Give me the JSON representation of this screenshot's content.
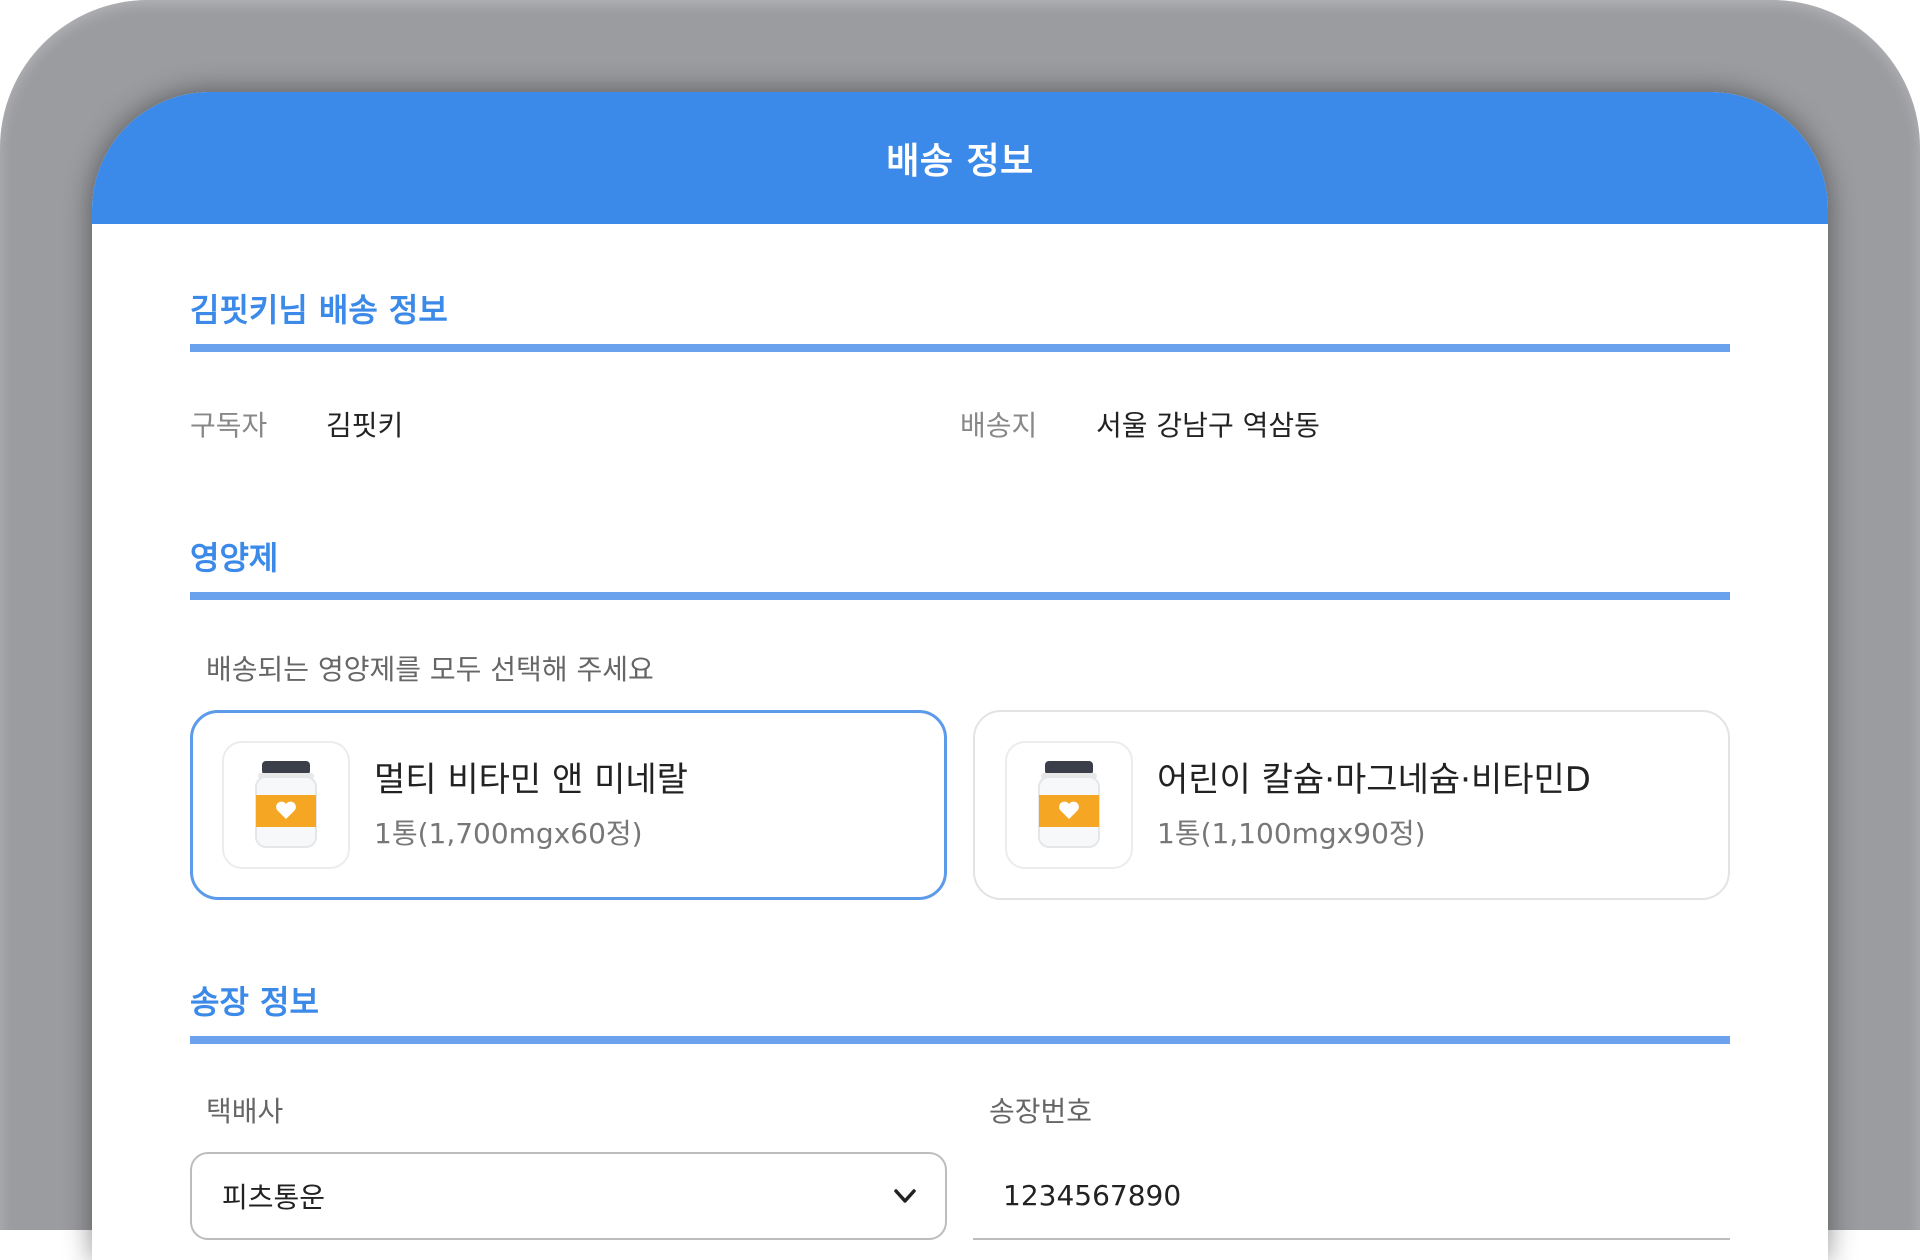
{
  "header": {
    "title": "배송 정보"
  },
  "delivery_info": {
    "title": "김핏키님 배송 정보",
    "subscriber_label": "구독자",
    "subscriber_value": "김핏키",
    "address_label": "배송지",
    "address_value": "서울 강남구 역삼동"
  },
  "supplements": {
    "title": "영양제",
    "hint": "배송되는 영양제를 모두 선택해 주세요",
    "items": [
      {
        "name": "멀티 비타민 앤 미네랄",
        "detail": "1통(1,700mgx60정)",
        "selected": true,
        "icon": "supplement-bottle-icon"
      },
      {
        "name": "어린이 칼슘·마그네슘·비타민D",
        "detail": "1통(1,100mgx90정)",
        "selected": false,
        "icon": "supplement-bottle-icon"
      }
    ]
  },
  "invoice": {
    "title": "송장 정보",
    "courier_label": "택배사",
    "courier_value": "피츠통운",
    "number_label": "송장번호",
    "number_value": "1234567890"
  },
  "colors": {
    "accent": "#3b89e8",
    "section_rule": "#6aa2ee",
    "bottle_label": "#f5a623",
    "bottle_cap": "#3a3f4a"
  }
}
